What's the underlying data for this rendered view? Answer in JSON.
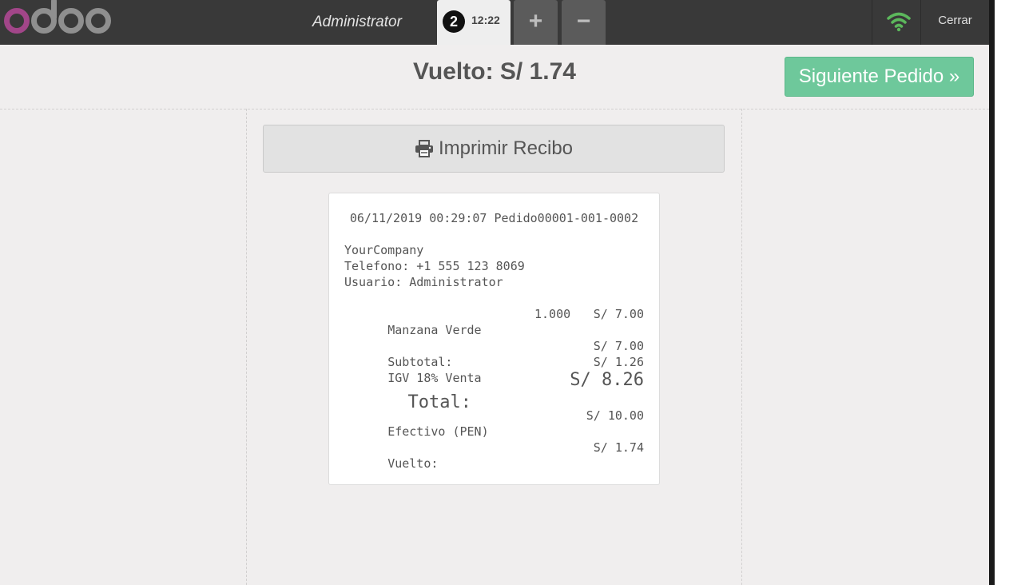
{
  "header": {
    "username": "Administrator",
    "order_seq": "2",
    "order_time": "12:22",
    "add_label": "+",
    "remove_label": "−",
    "close_label": "Cerrar"
  },
  "screen": {
    "change_title": "Vuelto: S/ 1.74",
    "next_order_label": "Siguiente Pedido »",
    "print_label": "Imprimir Recibo"
  },
  "receipt": {
    "header_line": "06/11/2019 00:29:07 Pedido00001-001-0002",
    "company": "YourCompany",
    "phone": "Telefono: +1 555 123 8069",
    "user": "Usuario: Administrator",
    "lines": [
      {
        "product": "Manzana Verde",
        "qty": "1.000",
        "price": "S/ 7.00"
      }
    ],
    "subtotal_label": "Subtotal:",
    "subtotal_value": "S/ 7.00",
    "tax_label": "IGV 18% Venta",
    "tax_value": "S/ 1.26",
    "total_label": "Total:",
    "total_value": "S/ 8.26",
    "payment_label": "Efectivo (PEN)",
    "payment_value": "S/ 10.00",
    "change_label": "Vuelto:",
    "change_value": "S/ 1.74"
  },
  "colors": {
    "header_bg": "#393939",
    "accent_green": "#6ec89b",
    "logo_purple": "#a24689",
    "wifi_green": "#5cb85c"
  }
}
